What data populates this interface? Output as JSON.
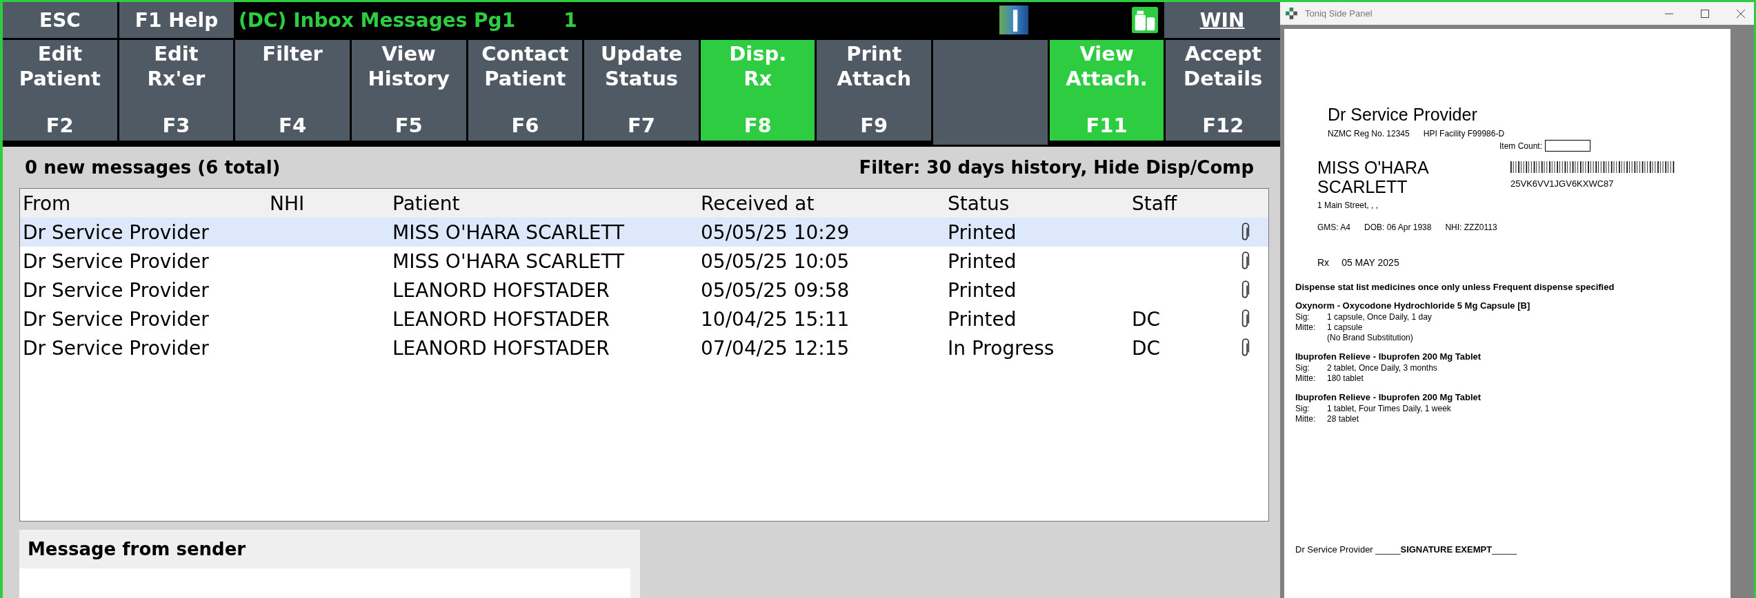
{
  "top_bar": {
    "esc": "ESC",
    "help": "F1 Help",
    "title": "(DC) Inbox Messages Pg1",
    "page_number": "1",
    "win": "WIN"
  },
  "function_keys": [
    {
      "kind": "key",
      "lines": [
        "Edit",
        "Patient"
      ],
      "key": "F2",
      "highlighted": false
    },
    {
      "kind": "key",
      "lines": [
        "Edit",
        "Rx'er"
      ],
      "key": "F3",
      "highlighted": false
    },
    {
      "kind": "key",
      "lines": [
        "Filter"
      ],
      "key": "F4",
      "highlighted": false
    },
    {
      "kind": "key",
      "lines": [
        "View",
        "History"
      ],
      "key": "F5",
      "highlighted": false
    },
    {
      "kind": "key",
      "lines": [
        "Contact",
        "Patient"
      ],
      "key": "F6",
      "highlighted": false
    },
    {
      "kind": "key",
      "lines": [
        "Update",
        "Status"
      ],
      "key": "F7",
      "highlighted": false
    },
    {
      "kind": "key",
      "lines": [
        "Disp.",
        "Rx"
      ],
      "key": "F8",
      "highlighted": true
    },
    {
      "kind": "key",
      "lines": [
        "Print",
        "Attach"
      ],
      "key": "F9",
      "highlighted": false
    },
    {
      "kind": "blank"
    },
    {
      "kind": "key",
      "lines": [
        "View",
        "Attach."
      ],
      "key": "F11",
      "highlighted": true
    },
    {
      "kind": "key",
      "lines": [
        "Accept",
        "Details"
      ],
      "key": "F12",
      "highlighted": false
    }
  ],
  "summary": "0 new messages (6 total)",
  "filter": "Filter: 30 days history, Hide Disp/Comp",
  "table": {
    "columns": [
      "From",
      "NHI",
      "Patient",
      "Received at",
      "Status",
      "Staff"
    ],
    "rows": [
      {
        "from": "Dr Service Provider",
        "patient": "MISS O'HARA SCARLETT",
        "received": "05/05/25 10:29",
        "status": "Printed",
        "staff": "",
        "attachment": true,
        "selected": true
      },
      {
        "from": "Dr Service Provider",
        "patient": "MISS O'HARA SCARLETT",
        "received": "05/05/25 10:05",
        "status": "Printed",
        "staff": "",
        "attachment": true,
        "selected": false
      },
      {
        "from": "Dr Service Provider",
        "patient": "LEANORD HOFSTADER",
        "received": "05/05/25 09:58",
        "status": "Printed",
        "staff": "",
        "attachment": true,
        "selected": false
      },
      {
        "from": "Dr Service Provider",
        "patient": "LEANORD HOFSTADER",
        "received": "10/04/25 15:11",
        "status": "Printed",
        "staff": "DC",
        "attachment": true,
        "selected": false
      },
      {
        "from": "Dr Service Provider",
        "patient": "LEANORD HOFSTADER",
        "received": "07/04/25 12:15",
        "status": "In Progress",
        "staff": "DC",
        "attachment": true,
        "selected": false
      }
    ]
  },
  "message_panel": {
    "title": "Message from sender"
  },
  "side_panel": {
    "window": {
      "title": "Toniq Side Panel"
    },
    "document": {
      "prescriber": "Dr Service Provider",
      "reg_no": "NZMC Reg No. 12345",
      "facility": "HPI Facility F99986-D",
      "item_count_label": "Item Count:",
      "patient_name": [
        "MISS O'HARA",
        "SCARLETT"
      ],
      "barcode_text": "25VK6VV1JGV6KXWC87",
      "address": "1 Main Street, , ,",
      "gms": "GMS: A4",
      "dob": "DOB: 06 Apr 1938",
      "nhi": "NHI: ZZZ0113",
      "rx_label": "Rx",
      "rx_date": "05 MAY 2025",
      "instruction": "Dispense stat list medicines once only unless Frequent dispense specified",
      "items": [
        {
          "name": "Oxynorm - Oxycodone Hydrochloride 5 Mg Capsule [B]",
          "sig_label": "Sig:",
          "sig": "1 capsule, Once Daily, 1 day",
          "mitte_label": "Mitte:",
          "mitte": "1 capsule",
          "note": "(No Brand Substitution)"
        },
        {
          "name": "Ibuprofen Relieve - Ibuprofen 200 Mg Tablet",
          "sig_label": "Sig:",
          "sig": "2 tablet, Once Daily, 3 months",
          "mitte_label": "Mitte:",
          "mitte": "180 tablet"
        },
        {
          "name": "Ibuprofen Relieve - Ibuprofen 200 Mg Tablet",
          "sig_label": "Sig:",
          "sig": "1 tablet, Four Times Daily, 1 week",
          "mitte_label": "Mitte:",
          "mitte": "28 tablet"
        }
      ],
      "signature": "Dr Service Provider _____**SIGNATURE EXEMPT**_____"
    }
  }
}
